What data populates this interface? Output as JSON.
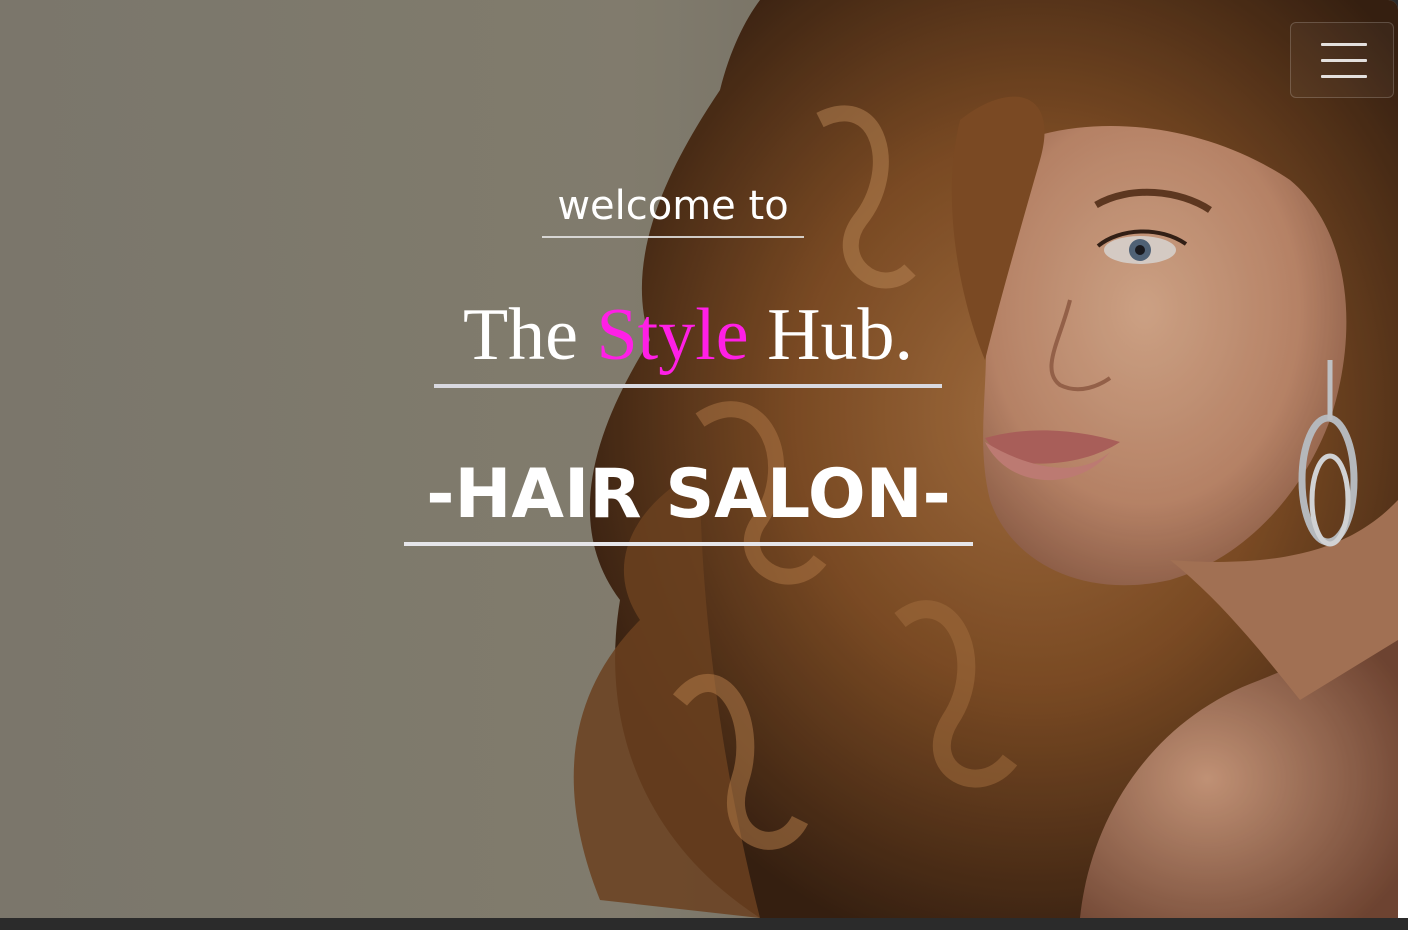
{
  "hero": {
    "welcome": "welcome to",
    "brand_part1": "The",
    "brand_accent": "Style",
    "brand_part2": "Hub.",
    "subtitle": "-HAIR SALON-"
  },
  "nav": {
    "menu_icon": "hamburger-menu-icon"
  },
  "colors": {
    "accent": "#ff1fe6",
    "text": "#ffffff",
    "background_tone": "#8f8a7c"
  }
}
